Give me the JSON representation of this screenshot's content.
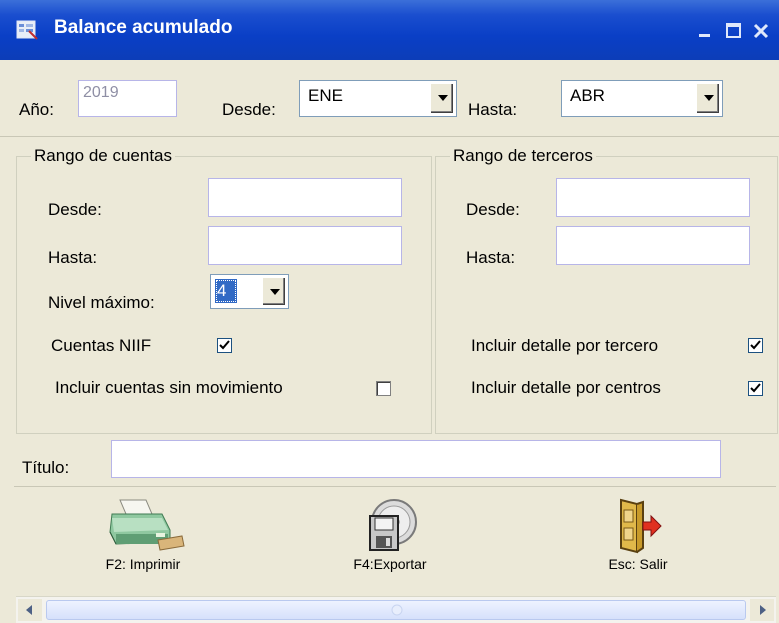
{
  "window": {
    "title": "Balance acumulado",
    "titlebar_color": "#0a3fc6"
  },
  "period": {
    "year_label": "Año:",
    "year_value": "2019",
    "from_label": "Desde:",
    "from_value": "ENE",
    "to_label": "Hasta:",
    "to_value": "ABR"
  },
  "accounts_group": {
    "legend": "Rango de cuentas",
    "from_label": "Desde:",
    "from_value": "",
    "to_label": "Hasta:",
    "to_value": "",
    "max_level_label": "Nivel máximo:",
    "max_level_value": "4",
    "niif_label": "Cuentas NIIF",
    "niif_checked": true,
    "no_movement_label": "Incluir cuentas sin movimiento",
    "no_movement_checked": false
  },
  "third_parties_group": {
    "legend": "Rango de terceros",
    "from_label": "Desde:",
    "from_value": "",
    "to_label": "Hasta:",
    "to_value": "",
    "detail_third_label": "Incluir detalle por tercero",
    "detail_third_checked": true,
    "detail_centers_label": "Incluir detalle por centros",
    "detail_centers_checked": true
  },
  "title_field": {
    "label": "Título:",
    "value": ""
  },
  "actions": {
    "print_label": "F2: Imprimir",
    "export_label": "F4:Exportar",
    "exit_label": "Esc: Salir"
  },
  "icons": {
    "app": "spreadsheet-icon",
    "minimize": "minimize-icon",
    "maximize": "maximize-icon",
    "close": "close-icon",
    "print": "printer-icon",
    "export": "disk-export-icon",
    "exit": "door-exit-icon"
  }
}
